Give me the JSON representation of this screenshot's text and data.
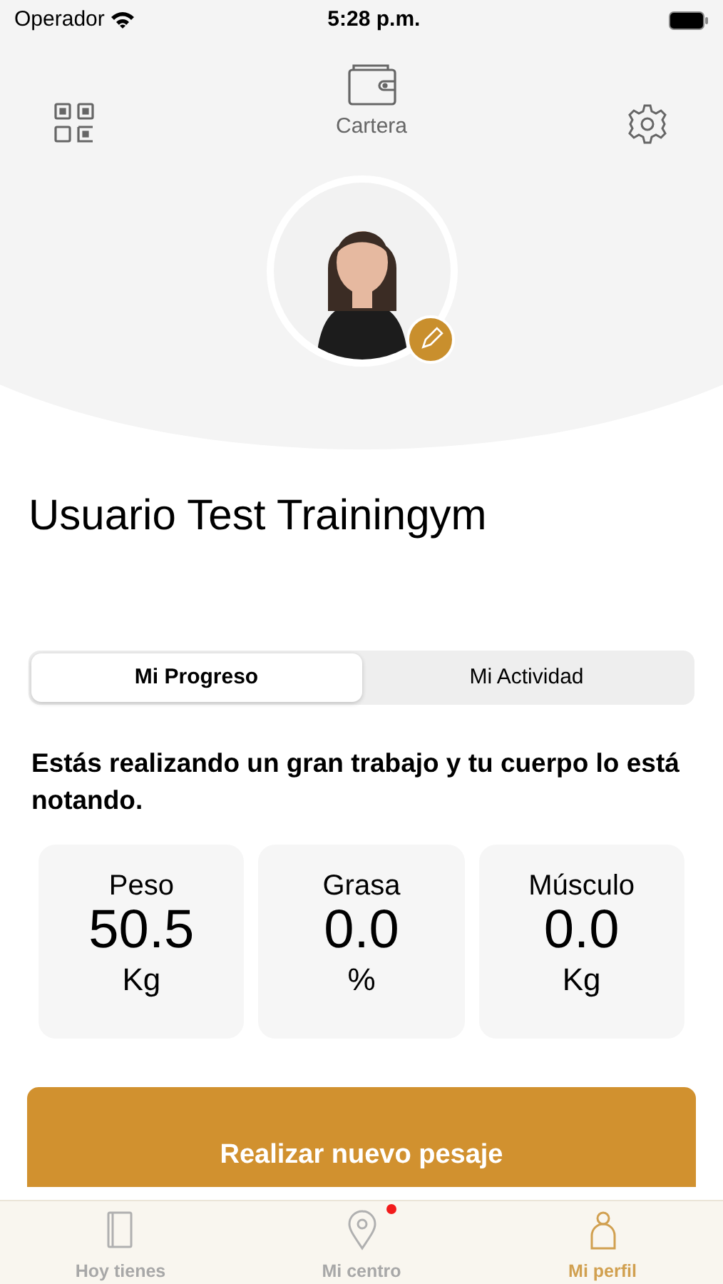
{
  "status_bar": {
    "carrier": "Operador",
    "time": "5:28 p.m."
  },
  "header": {
    "wallet_label": "Cartera"
  },
  "profile": {
    "name": "Usuario Test Trainingym"
  },
  "segments": [
    {
      "label": "Mi Progreso",
      "selected": true
    },
    {
      "label": "Mi Actividad",
      "selected": false
    }
  ],
  "message": "Estás realizando un gran trabajo y tu cuerpo lo está notando.",
  "metrics": [
    {
      "label": "Peso",
      "value": "50.5",
      "unit": "Kg"
    },
    {
      "label": "Grasa",
      "value": "0.0",
      "unit": "%"
    },
    {
      "label": "Músculo",
      "value": "0.0",
      "unit": "Kg"
    }
  ],
  "action_button": "Realizar nuevo pesaje",
  "tab_bar": [
    {
      "label": "Hoy tienes",
      "selected": false,
      "notification": false
    },
    {
      "label": "Mi centro",
      "selected": false,
      "notification": true
    },
    {
      "label": "Mi perfil",
      "selected": true,
      "notification": false
    }
  ]
}
